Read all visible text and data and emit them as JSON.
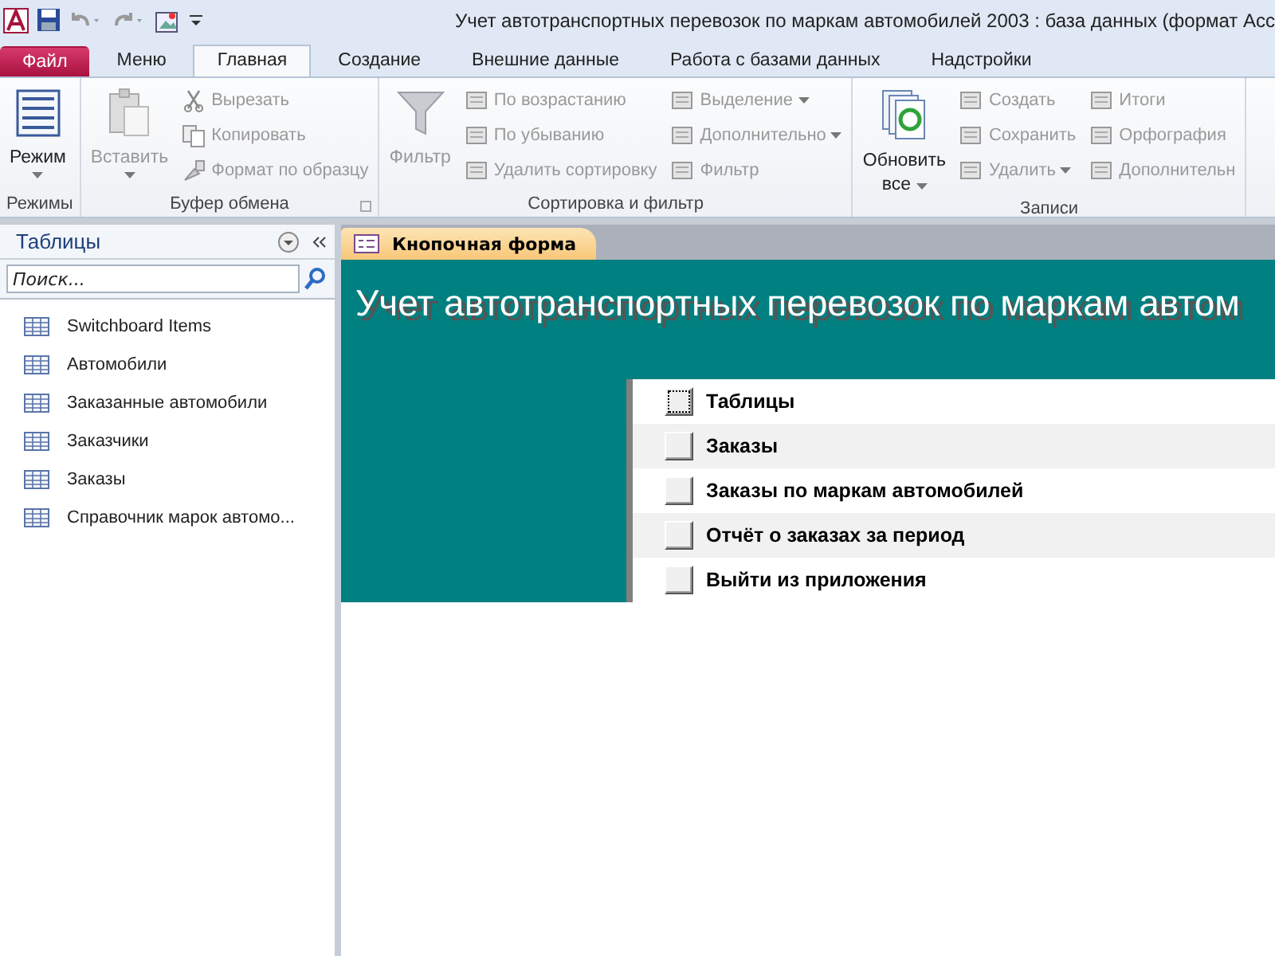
{
  "window": {
    "title": "Учет автотранспортных перевозок по маркам автомобилей 2003 : база данных (формат Acc"
  },
  "ribbon_tabs": [
    {
      "label": "Файл",
      "kind": "file",
      "selected": false
    },
    {
      "label": "Меню",
      "kind": "tab",
      "selected": false
    },
    {
      "label": "Главная",
      "kind": "tab",
      "selected": true
    },
    {
      "label": "Создание",
      "kind": "tab",
      "selected": false
    },
    {
      "label": "Внешние данные",
      "kind": "tab",
      "selected": false
    },
    {
      "label": "Работа с базами данных",
      "kind": "tab",
      "selected": false
    },
    {
      "label": "Надстройки",
      "kind": "tab",
      "selected": false
    }
  ],
  "ribbon_groups": [
    {
      "label": "Режимы",
      "large": {
        "label": "Режим",
        "menu": true,
        "disabled": false
      }
    },
    {
      "label": "Буфер обмена",
      "launcher": true,
      "large": {
        "label": "Вставить",
        "menu": true,
        "disabled": true
      },
      "columns": [
        [
          {
            "label": "Вырезать",
            "disabled": true
          },
          {
            "label": "Копировать",
            "disabled": true
          },
          {
            "label": "Формат по образцу",
            "disabled": true
          }
        ]
      ]
    },
    {
      "label": "Сортировка и фильтр",
      "large": {
        "label": "Фильтр",
        "disabled": true
      },
      "columns": [
        [
          {
            "label": "По возрастанию",
            "disabled": true
          },
          {
            "label": "По убыванию",
            "disabled": true
          },
          {
            "label": "Удалить сортировку",
            "disabled": true
          }
        ],
        [
          {
            "label": "Выделение",
            "menu": true,
            "disabled": true
          },
          {
            "label": "Дополнительно",
            "menu": true,
            "disabled": true
          },
          {
            "label": "Фильтр",
            "disabled": true
          }
        ]
      ]
    },
    {
      "label": "Записи",
      "large": {
        "label": "Обновить",
        "label2": "все",
        "menu": true,
        "disabled": false
      },
      "columns": [
        [
          {
            "label": "Создать",
            "disabled": true
          },
          {
            "label": "Сохранить",
            "disabled": true
          },
          {
            "label": "Удалить",
            "menu": true,
            "disabled": true
          }
        ],
        [
          {
            "label": "Итоги",
            "disabled": true
          },
          {
            "label": "Орфография",
            "disabled": true
          },
          {
            "label": "Дополнительн",
            "disabled": true
          }
        ]
      ]
    }
  ],
  "nav_pane": {
    "title": "Таблицы",
    "search": {
      "placeholder": "Поиск..."
    },
    "items": [
      {
        "label": "Switchboard Items"
      },
      {
        "label": "Автомобили"
      },
      {
        "label": "Заказанные автомобили"
      },
      {
        "label": "Заказчики"
      },
      {
        "label": "Заказы"
      },
      {
        "label": "Справочник марок автомо..."
      }
    ]
  },
  "document_tab": {
    "label": "Кнопочная форма",
    "selected": true
  },
  "form": {
    "title": "Учет автотранспортных перевозок по маркам автом",
    "items": [
      {
        "label": "Таблицы",
        "focused": true
      },
      {
        "label": "Заказы",
        "focused": false
      },
      {
        "label": "Заказы по маркам автомобилей",
        "focused": false
      },
      {
        "label": "Отчёт о заказах за период",
        "focused": false
      },
      {
        "label": "Выйти из приложения",
        "focused": false
      }
    ]
  }
}
